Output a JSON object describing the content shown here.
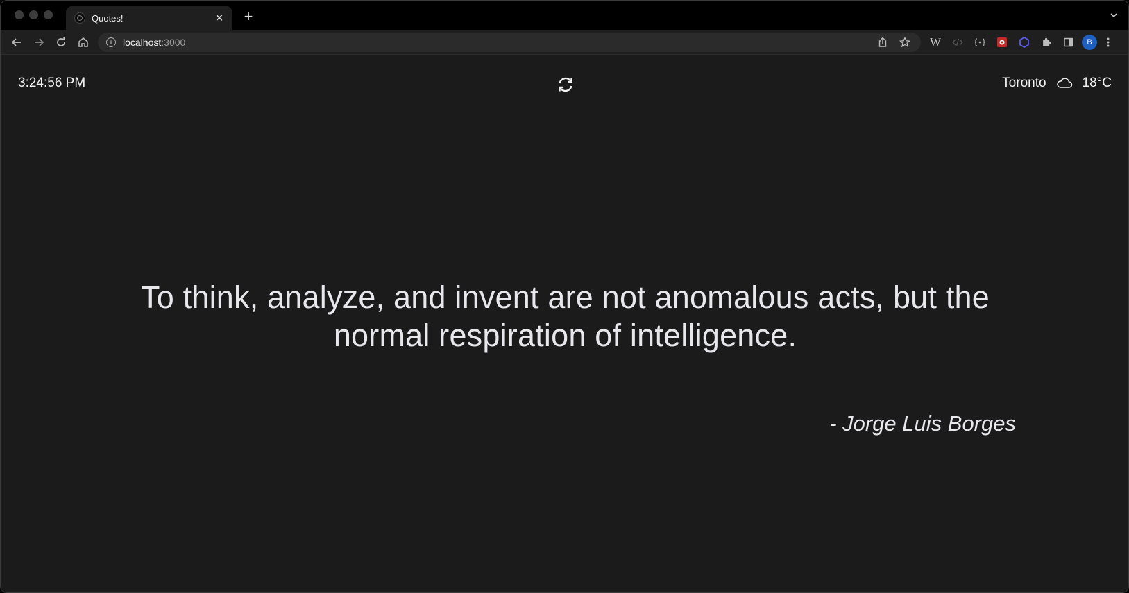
{
  "browser": {
    "tab_title": "Quotes!",
    "tab_close": "✕",
    "new_tab": "+",
    "url_host": "localhost",
    "url_port": ":3000",
    "profile_initial": "B",
    "extension_w": "W"
  },
  "page": {
    "time": "3:24:56 PM",
    "city": "Toronto",
    "temperature": "18°C",
    "weather_icon": "cloud-icon",
    "quote": "To think, analyze, and invent are not anomalous acts, but the normal respiration of intelligence.",
    "author": "- Jorge Luis Borges"
  },
  "colors": {
    "background": "#1b1b1b",
    "text": "#e7e7ec",
    "profile_avatar": "#1f5fbf"
  }
}
